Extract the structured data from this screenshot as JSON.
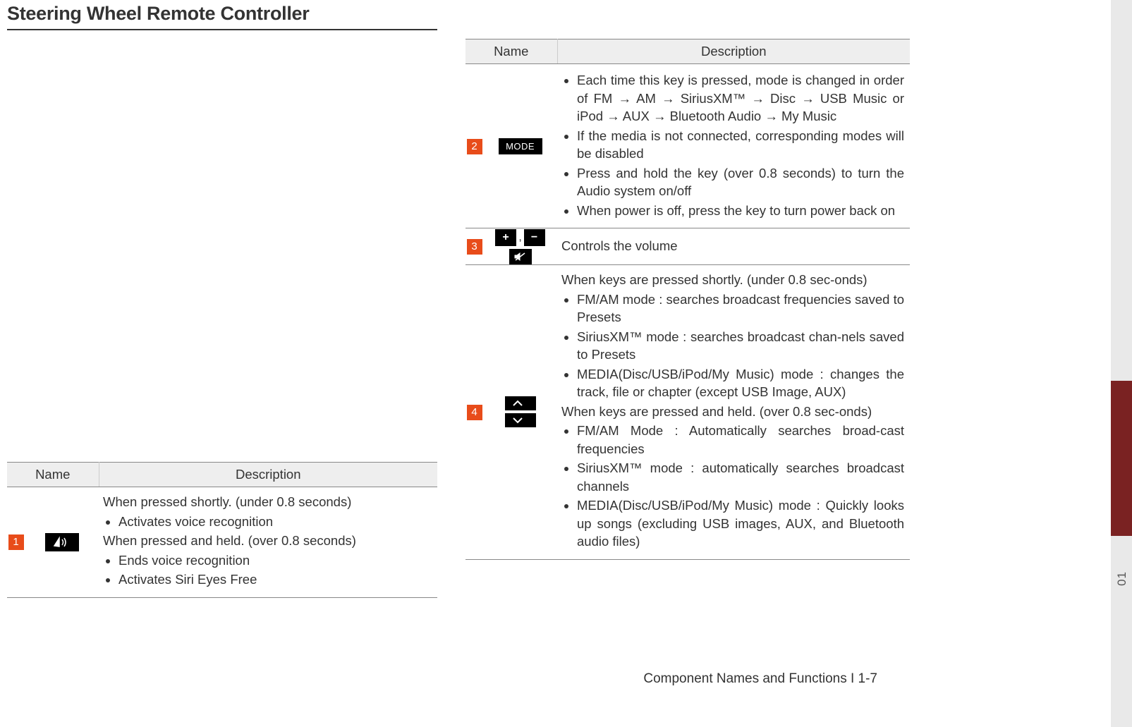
{
  "title": "Steering Wheel Remote Controller",
  "table_headers": {
    "name": "Name",
    "description": "Description"
  },
  "footer": "Component Names and Functions I 1-7",
  "side_label": "01",
  "row1": {
    "num": "1",
    "intro_a": "When pressed shortly. (under 0.8 seconds)",
    "b1": "Activates voice recognition",
    "intro_b": "When pressed and held. (over 0.8 seconds)",
    "b2": "Ends voice recognition",
    "b3": "Activates Siri Eyes Free"
  },
  "row2": {
    "num": "2",
    "mode_label": "MODE",
    "b1": "Each time this key is pressed, mode is changed in order of FM → AM → SiriusXM™ → Disc → USB Music or iPod → AUX → Bluetooth Audio → My Music",
    "b2": "If the media is not connected, corresponding modes will be disabled",
    "b3": "Press and hold the key (over 0.8 seconds) to turn the Audio system on/off",
    "b4": "When power is off, press the key to turn power back on"
  },
  "row3": {
    "num": "3",
    "plus": "+",
    "minus": "−",
    "desc": "Controls the volume"
  },
  "row4": {
    "num": "4",
    "intro_a": "When keys are pressed shortly. (under 0.8 sec-onds)",
    "a1": "FM/AM mode : searches broadcast frequencies saved to Presets",
    "a2": "SiriusXM™ mode : searches broadcast chan-nels saved to Presets",
    "a3": "MEDIA(Disc/USB/iPod/My Music) mode : changes the track, file or chapter (except USB Image, AUX)",
    "intro_b": "When keys are pressed and held. (over 0.8 sec-onds)",
    "b1": "FM/AM Mode : Automatically searches broad-cast frequencies",
    "b2": "SiriusXM™ mode : automatically searches broadcast channels",
    "b3": "MEDIA(Disc/USB/iPod/My Music) mode : Quickly looks up songs (excluding USB images, AUX, and Bluetooth audio files)"
  }
}
